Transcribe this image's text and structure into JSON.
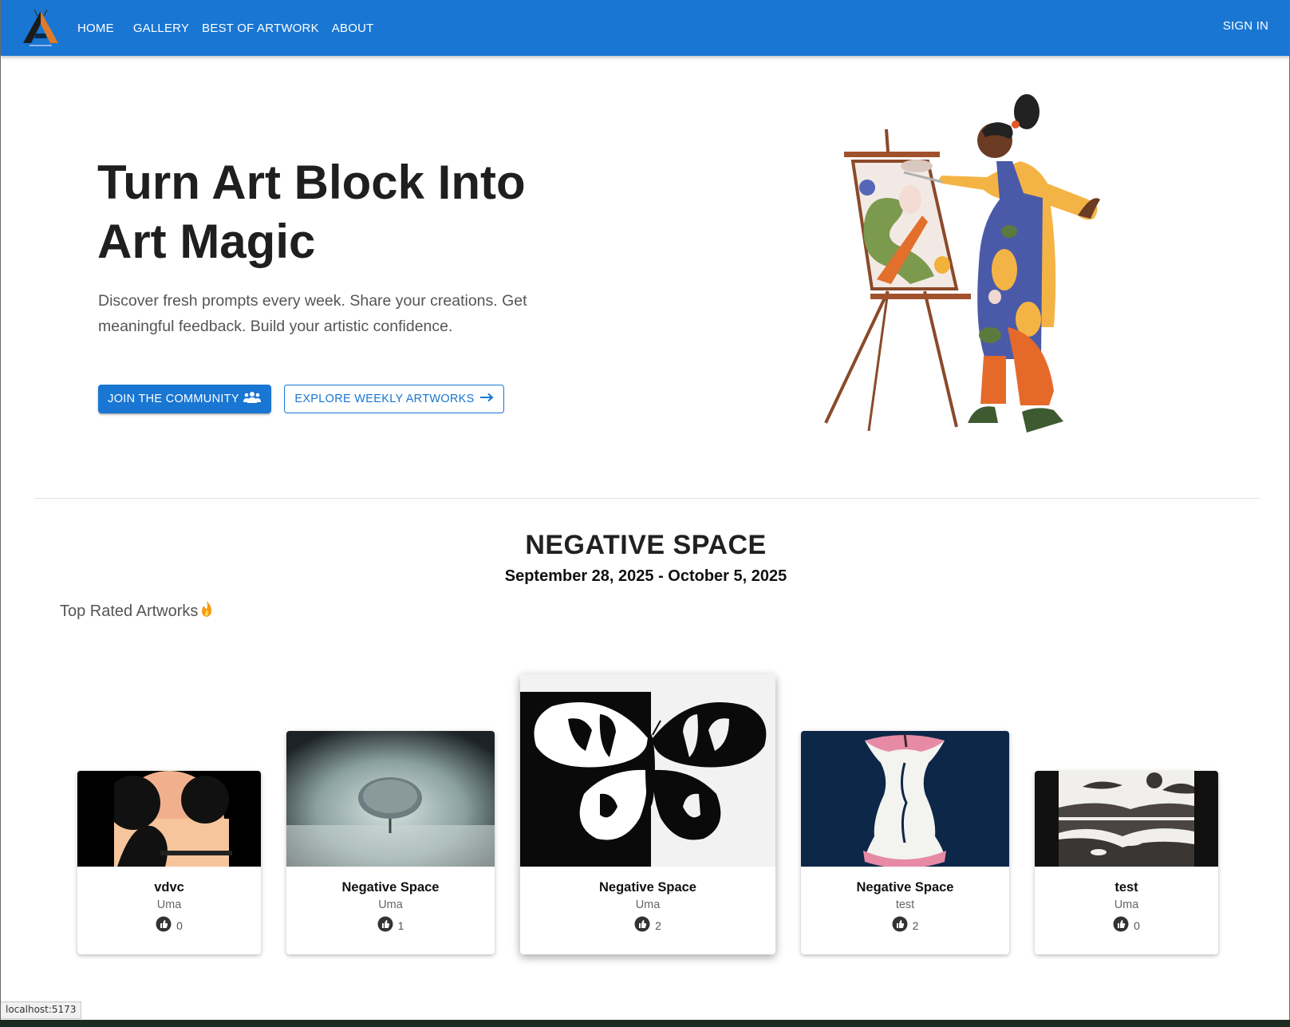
{
  "nav": {
    "items": [
      "HOME",
      "GALLERY",
      "BEST OF ARTWORK",
      "ABOUT"
    ],
    "sign_in": "SIGN IN"
  },
  "hero": {
    "title_line1": "Turn Art Block Into",
    "title_line2": "Art Magic",
    "subtitle": "Discover fresh prompts every week. Share your creations. Get meaningful feedback. Build your artistic confidence.",
    "primary_button": "JOIN THE COMMUNITY",
    "secondary_button": "EXPLORE WEEKLY ARTWORKS"
  },
  "theme": {
    "title": "NEGATIVE SPACE",
    "dates": "September 28, 2025 - October 5, 2025"
  },
  "top_rated": {
    "label": "Top Rated Artworks"
  },
  "artworks": [
    {
      "title": "vdvc",
      "author": "Uma",
      "likes": "0"
    },
    {
      "title": "Negative Space",
      "author": "Uma",
      "likes": "1"
    },
    {
      "title": "Negative Space",
      "author": "Uma",
      "likes": "2"
    },
    {
      "title": "Negative Space",
      "author": "test",
      "likes": "2"
    },
    {
      "title": "test",
      "author": "Uma",
      "likes": "0"
    }
  ],
  "status_bar": {
    "url": "localhost:5173"
  },
  "colors": {
    "primary": "#1976d2",
    "text": "#212121",
    "muted": "#555555"
  },
  "icons": {
    "community": "users-icon",
    "arrow": "arrow-right-icon",
    "fire": "fire-icon",
    "like": "thumbs-up-icon"
  }
}
